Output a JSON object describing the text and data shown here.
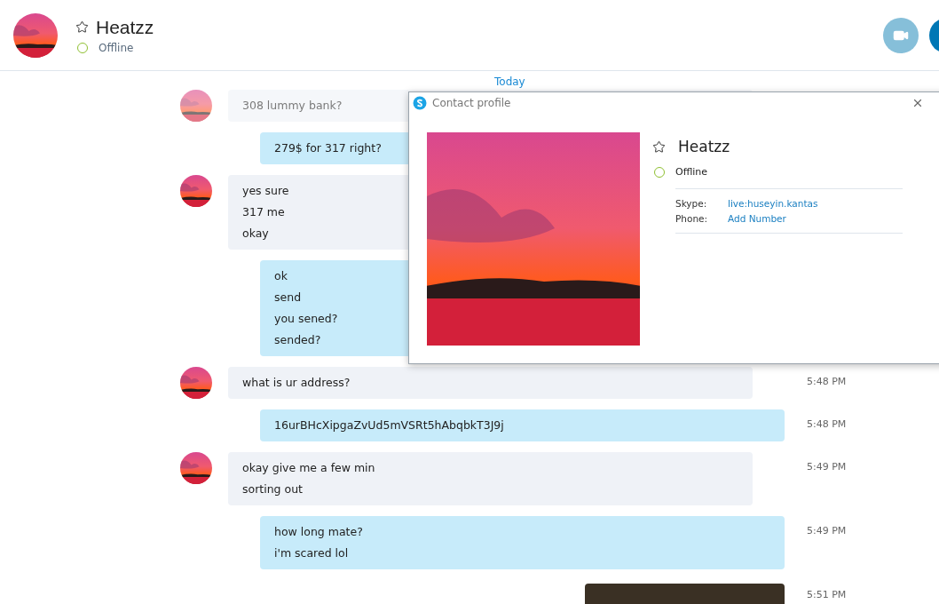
{
  "header": {
    "name": "Heatzz",
    "status": "Offline"
  },
  "chat": {
    "date_label": "Today",
    "messages": [
      {
        "kind": "incoming",
        "faded": true,
        "lines": [
          "308 lummy bank?"
        ]
      },
      {
        "kind": "outgoing",
        "faded": false,
        "lines": [
          "279$ for 317 right?"
        ]
      },
      {
        "kind": "incoming",
        "faded": false,
        "lines": [
          "yes sure",
          "317 me",
          "okay"
        ]
      },
      {
        "kind": "outgoing",
        "faded": false,
        "lines": [
          "ok",
          "send",
          "you sened?",
          "sended?"
        ]
      },
      {
        "kind": "incoming",
        "faded": false,
        "lines": [
          "what is ur address?"
        ],
        "time": "5:48 PM"
      },
      {
        "kind": "outgoing",
        "faded": false,
        "lines": [
          "16urBHcXipgaZvUd5mVSRt5hAbqbkT3J9j"
        ],
        "time": "5:48 PM"
      },
      {
        "kind": "incoming",
        "faded": false,
        "lines": [
          "okay give me a few min",
          "sorting out"
        ],
        "time": "5:49 PM"
      },
      {
        "kind": "outgoing",
        "faded": false,
        "lines": [
          "how long mate?",
          "i'm scared lol"
        ],
        "time": "5:49 PM"
      },
      {
        "kind": "image",
        "faded": false,
        "time": "5:51 PM"
      }
    ]
  },
  "profile_dialog": {
    "title": "Contact profile",
    "name": "Heatzz",
    "status": "Offline",
    "fields": [
      {
        "label": "Skype:",
        "value": "live:huseyin.kantas"
      },
      {
        "label": "Phone:",
        "value": "Add Number"
      }
    ]
  }
}
